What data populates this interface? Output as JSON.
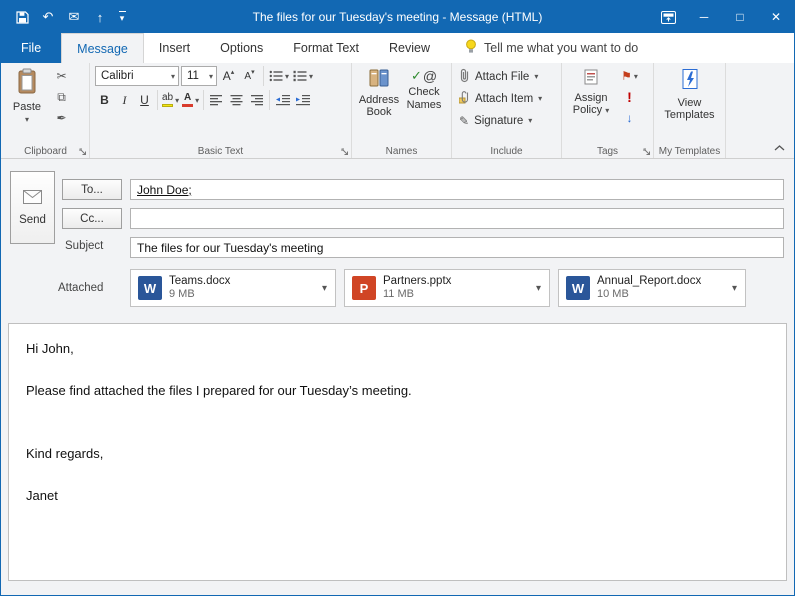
{
  "titlebar": {
    "title": "The files for our Tuesday's meeting  -  Message (HTML)"
  },
  "glyphs": {
    "dropdown": "▾",
    "undo": "↶",
    "mail": "✉",
    "up_arrow": "↑",
    "down_arrow": "↓",
    "minimize": "─",
    "maximize": "□",
    "close": "✕",
    "cut": "✂",
    "copy": "⧉",
    "format_painter": "✒",
    "grow_shrink_letter": "A",
    "bold": "B",
    "italic": "I",
    "underline": "U",
    "highlight": "ab",
    "font_color": "A",
    "signature_pen": "✎",
    "flag": "⚑",
    "high_importance": "!",
    "low_importance": "↓",
    "check": "✓",
    "at_sign": "@"
  },
  "tabs": {
    "file": "File",
    "items": [
      "Message",
      "Insert",
      "Options",
      "Format Text",
      "Review"
    ],
    "active": "Message",
    "tellme": "Tell me what you want to do"
  },
  "ribbon": {
    "clipboard": {
      "label": "Clipboard",
      "paste": "Paste"
    },
    "basic_text": {
      "label": "Basic Text",
      "font": "Calibri",
      "size": "11"
    },
    "names": {
      "label": "Names",
      "address_book": "Address Book",
      "check_names": "Check Names"
    },
    "include": {
      "label": "Include",
      "attach_file": "Attach File",
      "attach_item": "Attach Item",
      "signature": "Signature"
    },
    "tags": {
      "label": "Tags",
      "assign_policy": "Assign Policy"
    },
    "my_templates": {
      "label": "My Templates",
      "view_templates": "View Templates"
    }
  },
  "envelope": {
    "send": "Send",
    "to_button": "To...",
    "cc_button": "Cc...",
    "subject_label": "Subject",
    "attached_label": "Attached",
    "to_value": "John Doe;",
    "cc_value": "",
    "subject_value": "The files for our Tuesday's meeting",
    "attachments": [
      {
        "name": "Teams.docx",
        "size": "9 MB",
        "badge": "W"
      },
      {
        "name": "Partners.pptx",
        "size": "11 MB",
        "badge": "P"
      },
      {
        "name": "Annual_Report.docx",
        "size": "10 MB",
        "badge": "W"
      }
    ]
  },
  "body": {
    "lines": [
      "Hi John,",
      "",
      "Please find attached the files I prepared for our Tuesday’s meeting.",
      "",
      "",
      "Kind regards,",
      "",
      "Janet"
    ]
  },
  "colors": {
    "titlebar_blue": "#1268b3",
    "word_blue": "#2a5699",
    "powerpoint_orange": "#d04525",
    "flag_red": "#c43e1c",
    "importance_red": "#c00000",
    "low_importance_blue": "#2b6cd4",
    "highlight_yellow": "#f3e612",
    "font_color_red": "#d83b2d"
  }
}
